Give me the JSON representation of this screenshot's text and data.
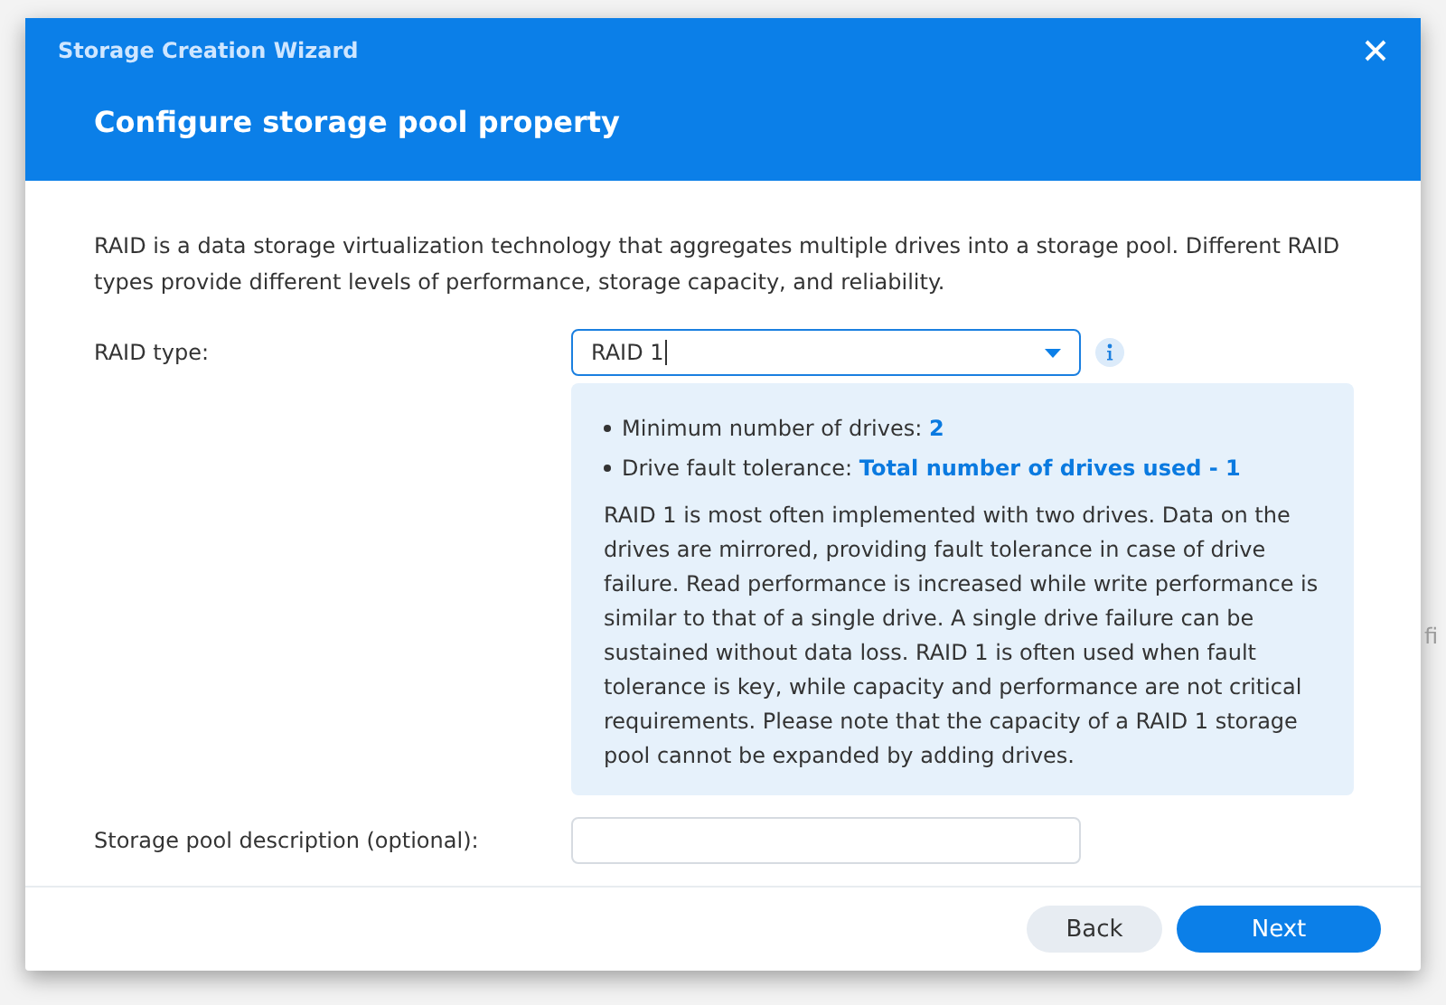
{
  "window": {
    "title": "Storage Creation Wizard"
  },
  "heading": "Configure storage pool property",
  "intro": "RAID is a data storage virtualization technology that aggregates multiple drives into a storage pool. Different RAID types provide different levels of performance, storage capacity, and reliability.",
  "raid_type": {
    "label": "RAID type:",
    "value": "RAID 1",
    "focused": true
  },
  "info_panel": {
    "facts": [
      {
        "label": "Minimum number of drives:",
        "value": "2"
      },
      {
        "label": "Drive fault tolerance:",
        "value": "Total number of drives used - 1"
      }
    ],
    "description": "RAID 1 is most often implemented with two drives. Data on the drives are mirrored, providing fault tolerance in case of drive failure. Read performance is increased while write performance is similar to that of a single drive. A single drive failure can be sustained without data loss. RAID 1 is often used when fault tolerance is key, while capacity and performance are not critical requirements. Please note that the capacity of a RAID 1 storage pool cannot be expanded by adding drives."
  },
  "description_field": {
    "label": "Storage pool description (optional):"
  },
  "buttons": [
    {
      "label": "Back",
      "kind": "secondary"
    },
    {
      "label": "Next",
      "kind": "primary"
    }
  ],
  "background_text": "fi"
}
